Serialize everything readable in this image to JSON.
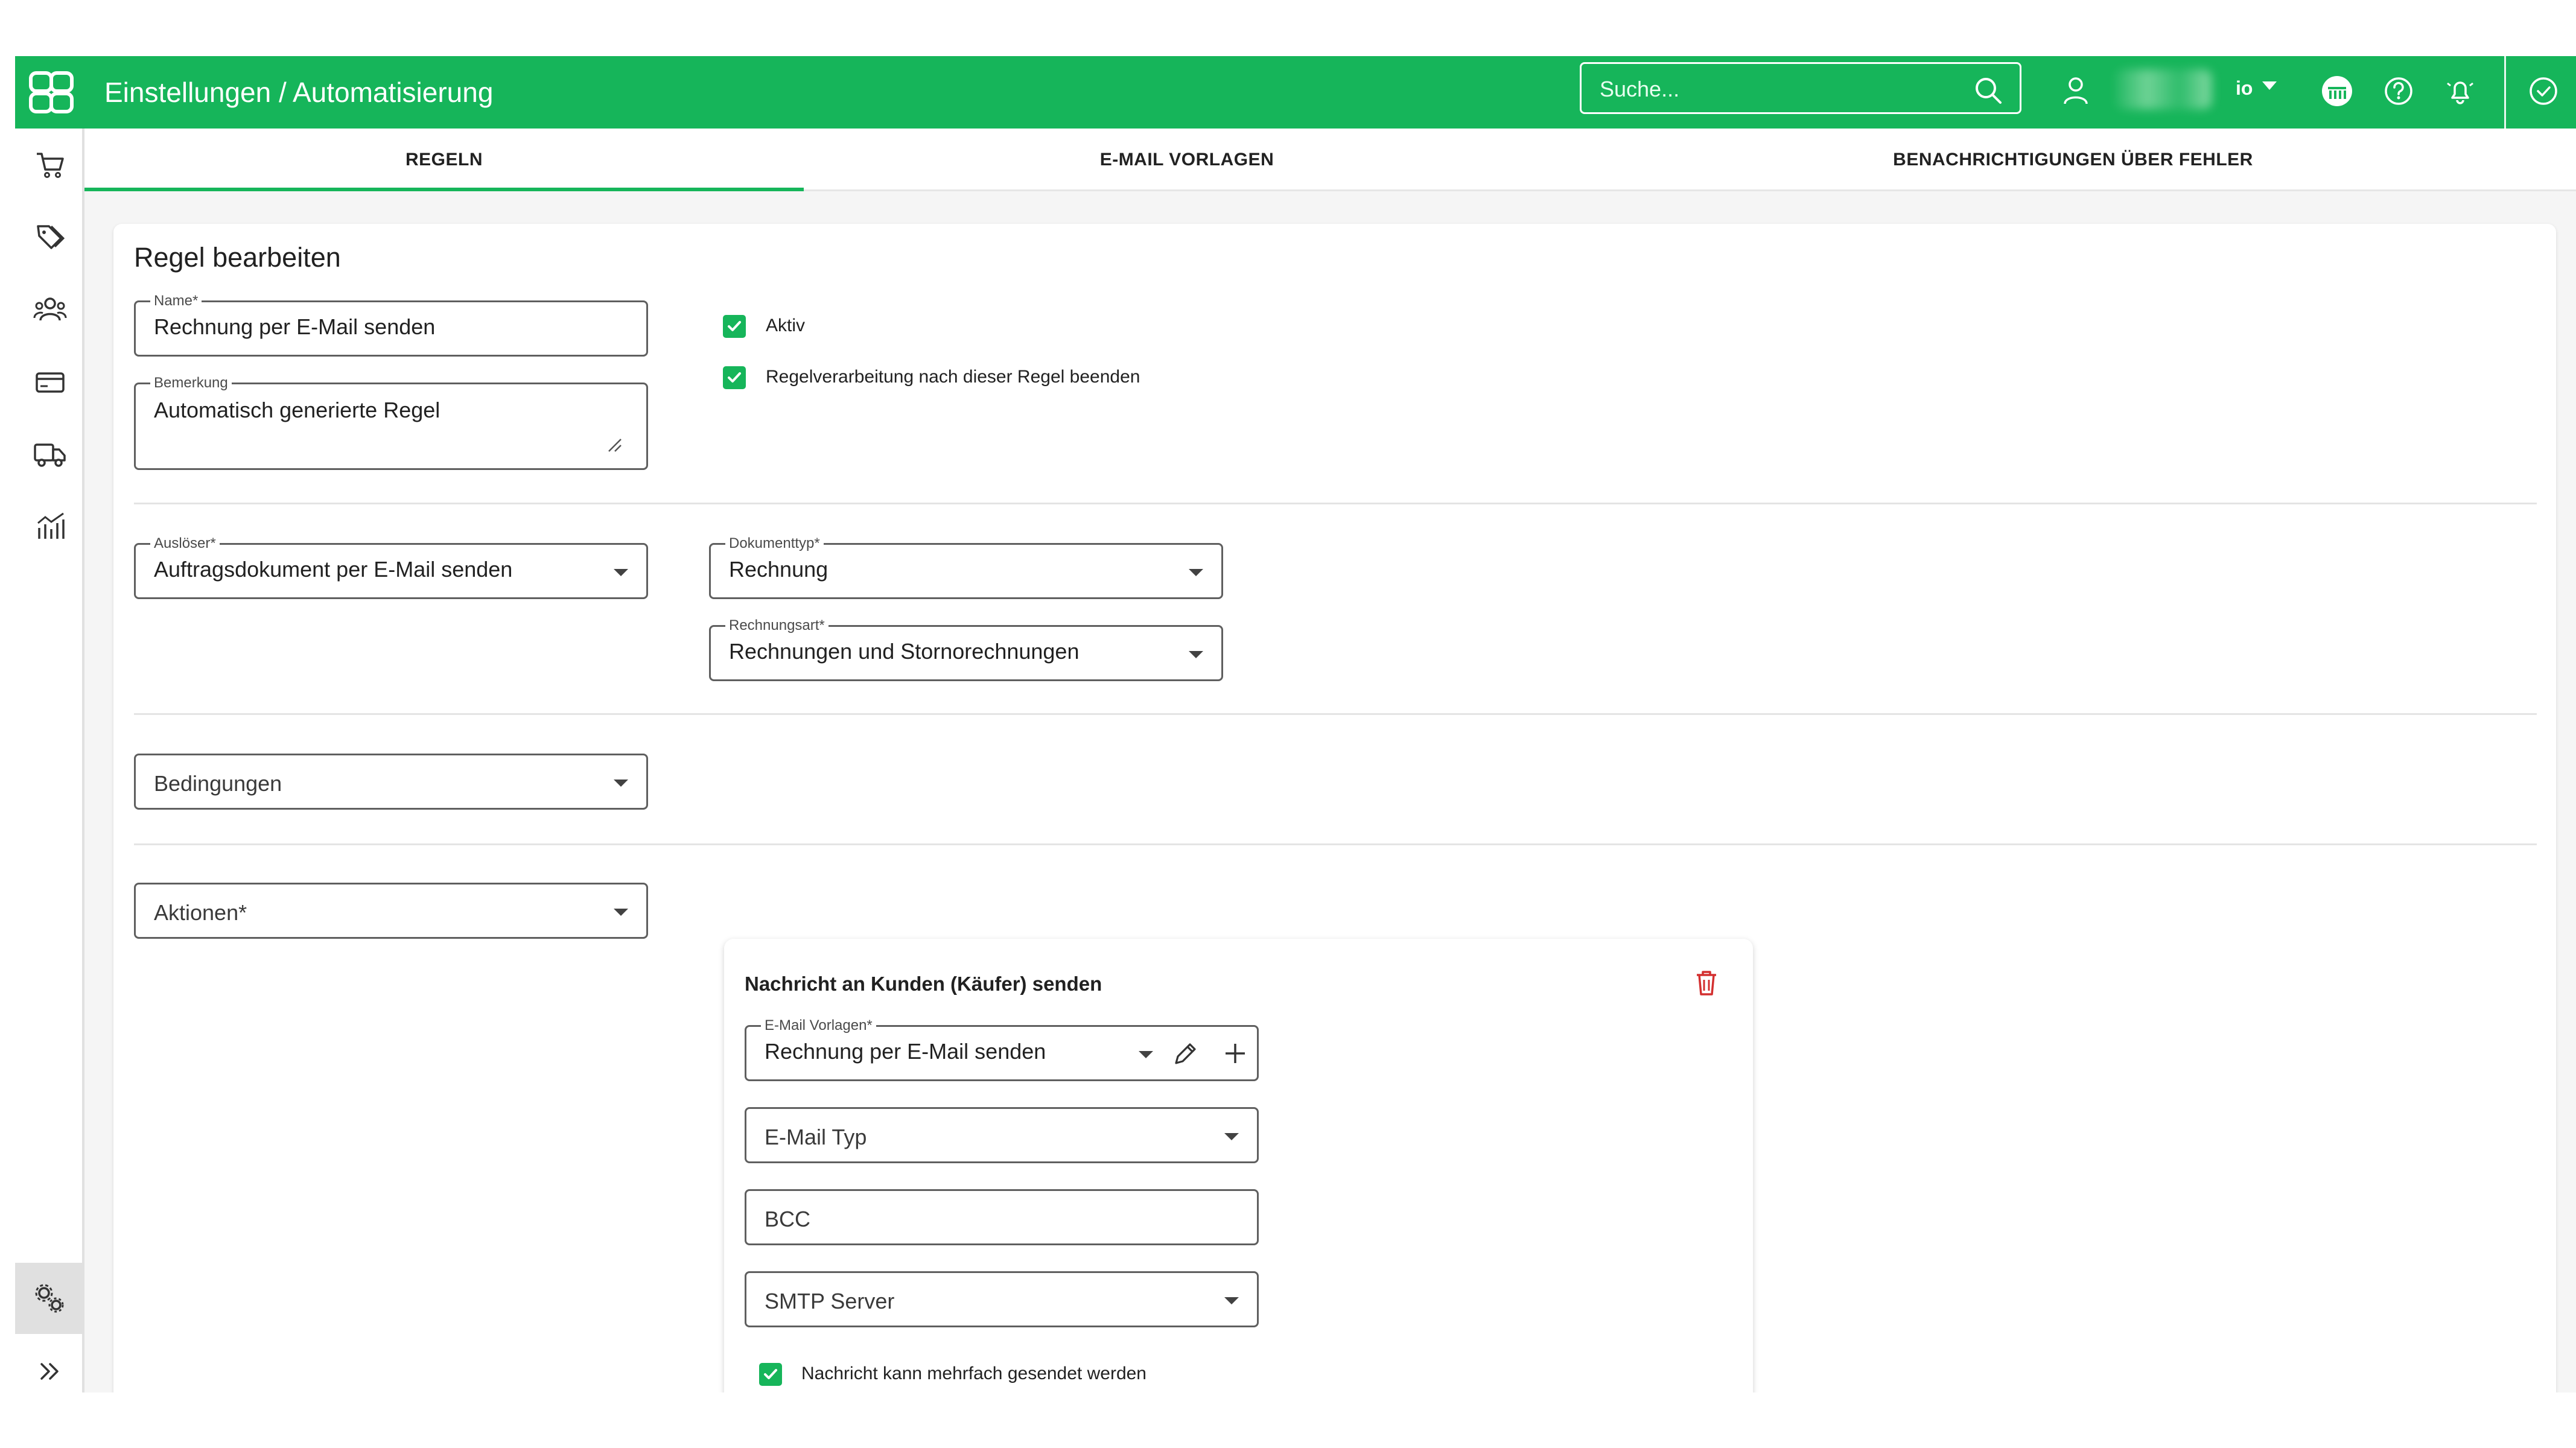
{
  "app": {
    "breadcrumb": "Einstellungen / Automatisierung",
    "brand_color": "#16b55a"
  },
  "topbar": {
    "search_placeholder": "Suche...",
    "user_short": "io"
  },
  "tabs": [
    {
      "label": "REGELN",
      "active": true
    },
    {
      "label": "E-MAIL VORLAGEN",
      "active": false
    },
    {
      "label": "BENACHRICHTIGUNGEN ÜBER FEHLER",
      "active": false
    }
  ],
  "form": {
    "title": "Regel bearbeiten",
    "name_label": "Name*",
    "name_value": "Rechnung per E-Mail senden",
    "remark_label": "Bemerkung",
    "remark_value": "Automatisch generierte Regel",
    "active_label": "Aktiv",
    "active_checked": true,
    "stop_label": "Regelverarbeitung nach dieser Regel beenden",
    "stop_checked": true,
    "trigger_label": "Auslöser*",
    "trigger_value": "Auftragsdokument per E-Mail senden",
    "doctype_label": "Dokumenttyp*",
    "doctype_value": "Rechnung",
    "invoicetype_label": "Rechnungsart*",
    "invoicetype_value": "Rechnungen und Stornorechnungen",
    "conditions_placeholder": "Bedingungen",
    "actions_placeholder": "Aktionen*"
  },
  "action": {
    "title": "Nachricht an Kunden (Käufer) senden",
    "template_label": "E-Mail Vorlagen*",
    "template_value": "Rechnung per E-Mail senden",
    "email_type_placeholder": "E-Mail Typ",
    "bcc_placeholder": "BCC",
    "smtp_placeholder": "SMTP Server",
    "multi_send_label": "Nachricht kann mehrfach gesendet werden",
    "multi_send_checked": true
  },
  "icons": {
    "sidebar": [
      "cart-icon",
      "tags-icon",
      "users-icon",
      "credit-card-icon",
      "truck-icon",
      "analytics-icon",
      "settings-gears-icon",
      "expand-chevrons-icon"
    ],
    "topbar": [
      "search-icon",
      "user-icon",
      "shop-icon",
      "help-icon",
      "notification-bell-icon",
      "check-circle-icon"
    ],
    "delete": "trash-icon",
    "edit": "pencil-icon",
    "add": "plus-icon"
  }
}
